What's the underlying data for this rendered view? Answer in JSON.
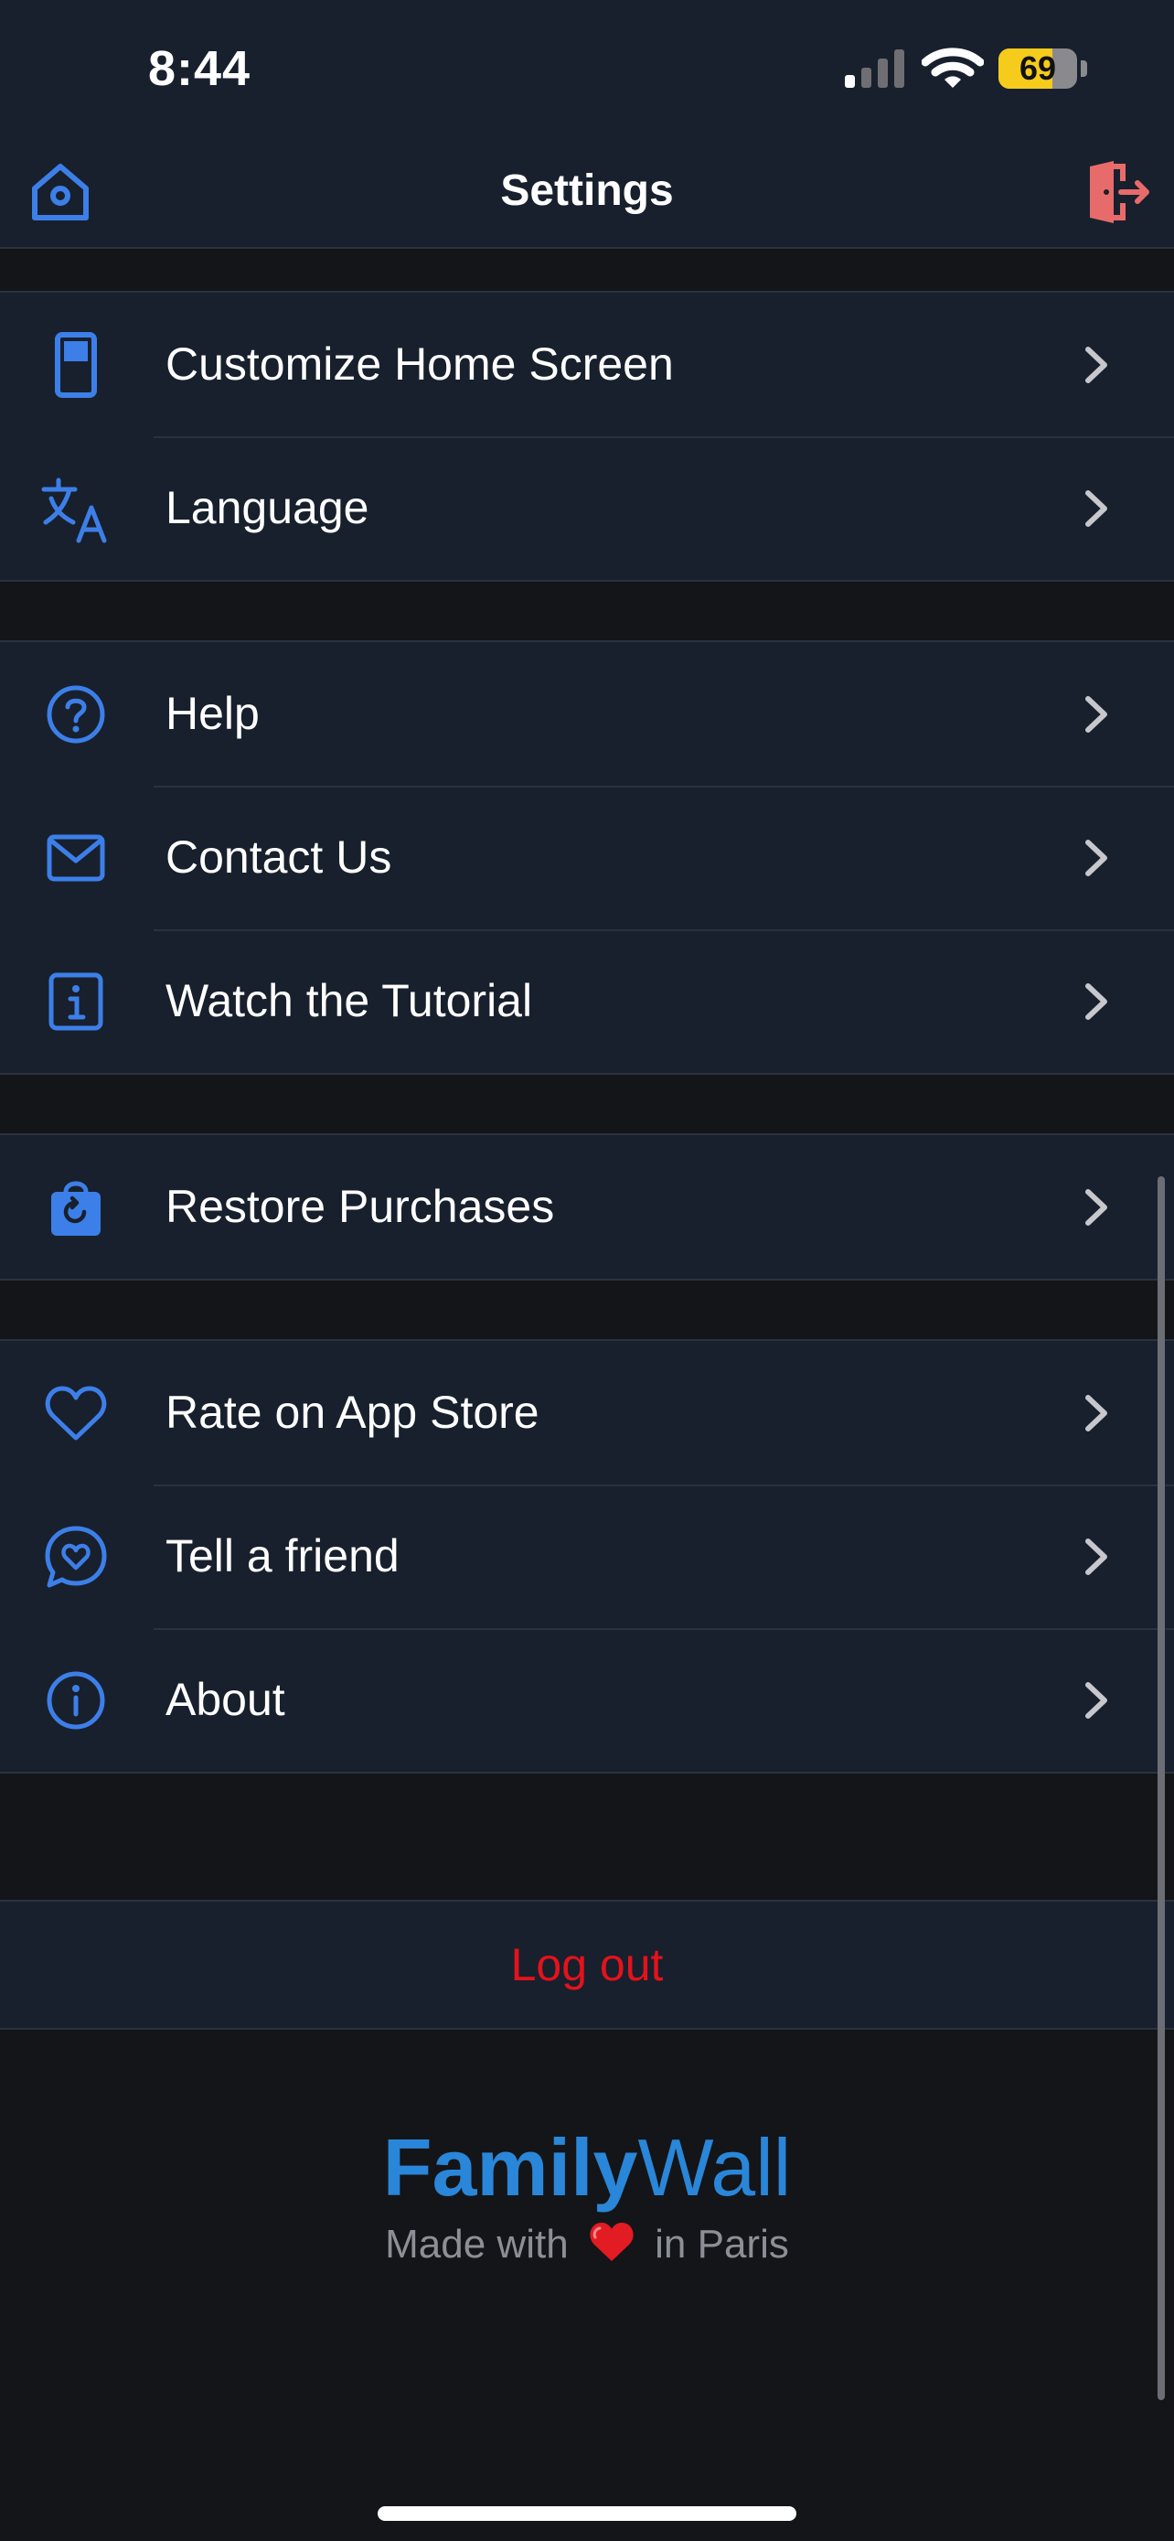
{
  "status_bar": {
    "time": "8:44",
    "battery_percent": 69,
    "battery_label": "69"
  },
  "header": {
    "title": "Settings",
    "left_icon": "home-icon",
    "right_icon": "exit-door-icon"
  },
  "groups": [
    {
      "items": [
        {
          "label": "Customize Home Screen",
          "icon": "phone-screen-icon"
        },
        {
          "label": "Language",
          "icon": "translate-icon"
        }
      ]
    },
    {
      "items": [
        {
          "label": "Help",
          "icon": "question-circle-icon"
        },
        {
          "label": "Contact Us",
          "icon": "envelope-icon"
        },
        {
          "label": "Watch the Tutorial",
          "icon": "info-square-icon"
        }
      ]
    },
    {
      "items": [
        {
          "label": "Restore Purchases",
          "icon": "shopping-bag-restore-icon"
        }
      ]
    },
    {
      "items": [
        {
          "label": "Rate on App Store",
          "icon": "heart-icon"
        },
        {
          "label": "Tell a friend",
          "icon": "chat-heart-icon"
        },
        {
          "label": "About",
          "icon": "info-circle-icon"
        }
      ]
    }
  ],
  "logout": {
    "label": "Log out"
  },
  "footer": {
    "brand_part1": "Family",
    "brand_part2": "Wall",
    "tagline_before": "Made with",
    "tagline_after": "in Paris"
  },
  "colors": {
    "background": "#141518",
    "panel": "#18202d",
    "accent_blue": "#3d7fe8",
    "logout_red": "#e4121b",
    "exit_icon_red": "#e86b6b",
    "brand_blue": "#2a86d8"
  }
}
